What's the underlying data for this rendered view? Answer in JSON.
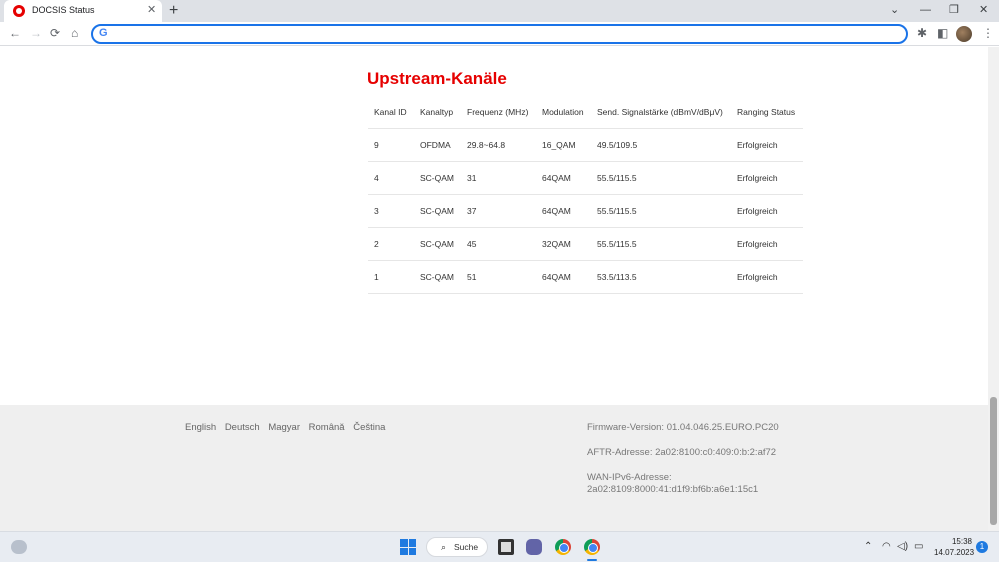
{
  "browser": {
    "tab_title": "DOCSIS Status",
    "tab_close": "✕",
    "new_tab": "+",
    "address_value": ""
  },
  "window_controls": {
    "dropdown": "⌄",
    "minimize": "—",
    "restore": "❐",
    "close": "✕"
  },
  "toolbar": {
    "back": "←",
    "forward": "→",
    "reload": "⟳",
    "home": "⌂",
    "extensions": "✱",
    "sidepanel": "◧",
    "menu": "⋮"
  },
  "page": {
    "section_title": "Upstream-Kanäle",
    "table": {
      "headers": [
        "Kanal ID",
        "Kanaltyp",
        "Frequenz (MHz)",
        "Modulation",
        "Send. Signalstärke (dBmV/dBμV)",
        "Ranging Status"
      ],
      "rows": [
        [
          "9",
          "OFDMA",
          "29.8~64.8",
          "16_QAM",
          "49.5/109.5",
          "Erfolgreich"
        ],
        [
          "4",
          "SC-QAM",
          "31",
          "64QAM",
          "55.5/115.5",
          "Erfolgreich"
        ],
        [
          "3",
          "SC-QAM",
          "37",
          "64QAM",
          "55.5/115.5",
          "Erfolgreich"
        ],
        [
          "2",
          "SC-QAM",
          "45",
          "32QAM",
          "55.5/115.5",
          "Erfolgreich"
        ],
        [
          "1",
          "SC-QAM",
          "51",
          "64QAM",
          "53.5/113.5",
          "Erfolgreich"
        ]
      ]
    }
  },
  "footer": {
    "languages": [
      "English",
      "Deutsch",
      "Magyar",
      "Română",
      "Čeština"
    ],
    "firmware": "Firmware-Version: 01.04.046.25.EURO.PC20",
    "aftr": "AFTR-Adresse: 2a02:8100:c0:409:0:b:2:af72",
    "wan_label": "WAN-IPv6-Adresse:",
    "wan_value": "2a02:8109:8000:41:d1f9:bf6b:a6e1:15c1"
  },
  "taskbar": {
    "search_label": "Suche",
    "search_glyph": "⌕",
    "tray": {
      "chevron": "⌃",
      "wifi": "◠",
      "volume": "◁)",
      "battery": "▭"
    },
    "time": "15:38",
    "date": "14.07.2023",
    "notifications": "1"
  }
}
